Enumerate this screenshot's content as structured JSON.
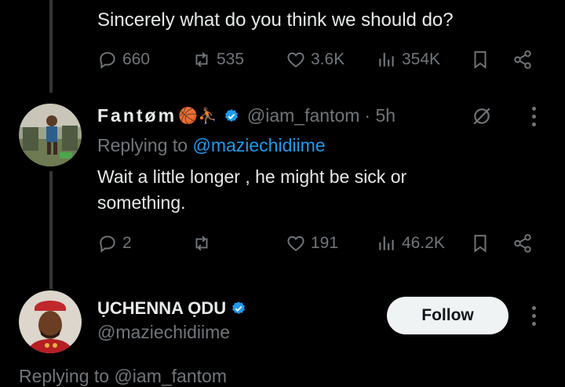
{
  "top_tweet": {
    "text": "Sincerely what do you think we should do?",
    "replies": "660",
    "retweets": "535",
    "likes": "3.6K",
    "views": "354K"
  },
  "reply_tweet": {
    "display_name": "Fantøm",
    "name_emojis": "🏀⛹🏾",
    "handle": "@iam_fantom",
    "time": "· 5h",
    "replying_prefix": "Replying to",
    "replying_handle": "@maziechidiime",
    "text_line1": "Wait a little longer , he might be sick or",
    "text_line2": "something.",
    "replies": "2",
    "retweets": "",
    "likes": "191",
    "views": "46.2K"
  },
  "author_tweet": {
    "display_name": "ỤCHENNA ỌDU",
    "handle": "@maziechidiime",
    "follow_label": "Follow",
    "replying_partial": "Replying to @iam_fantom"
  },
  "colors": {
    "background": "#000000",
    "text": "#e7e9ea",
    "muted": "#71767b",
    "link": "#1d9bf0",
    "verified": "#1d9bf0"
  }
}
